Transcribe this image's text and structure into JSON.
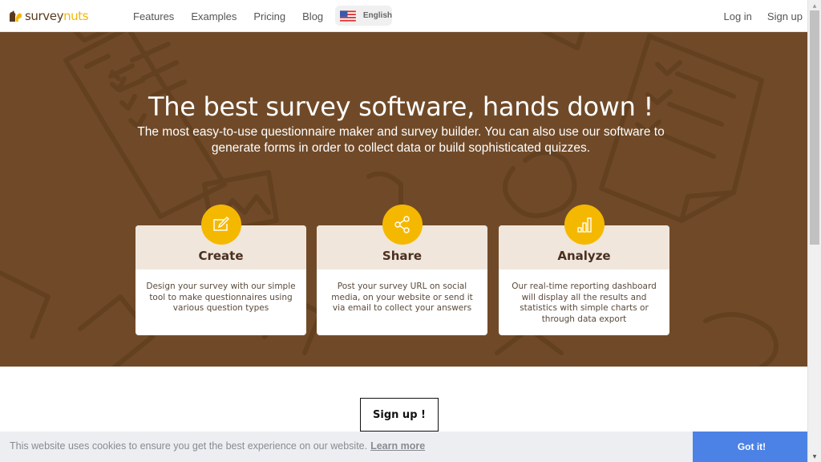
{
  "header": {
    "logo": {
      "part1": "survey",
      "part2": "nuts"
    },
    "nav": [
      "Features",
      "Examples",
      "Pricing",
      "Blog"
    ],
    "language": {
      "label": "English",
      "flag": "us-flag-icon"
    },
    "login": "Log in",
    "signup": "Sign up"
  },
  "hero": {
    "title": "The best survey software, hands down !",
    "subtitle": "The most easy-to-use questionnaire maker and survey builder. You can also use our software to generate forms in order to collect data or build sophisticated quizzes.",
    "cards": [
      {
        "title": "Create",
        "icon": "edit-icon",
        "desc": "Design your survey with our simple tool to make questionnaires using various question types"
      },
      {
        "title": "Share",
        "icon": "share-icon",
        "desc": "Post your survey URL on social media, on your website or send it via email to collect your answers"
      },
      {
        "title": "Analyze",
        "icon": "bar-chart-icon",
        "desc": "Our real-time reporting dashboard will display all the results and statistics with simple charts or through data export"
      }
    ]
  },
  "cta": {
    "signup": "Sign up !"
  },
  "cookie": {
    "text": "This website uses cookies to ensure you get the best experience on our website.",
    "learn_more": "Learn more",
    "accept": "Got it!"
  },
  "colors": {
    "hero_bg": "#704a28",
    "accent": "#f5b800",
    "card_head": "#f0e6db",
    "cookie_button": "#4c82e6"
  }
}
